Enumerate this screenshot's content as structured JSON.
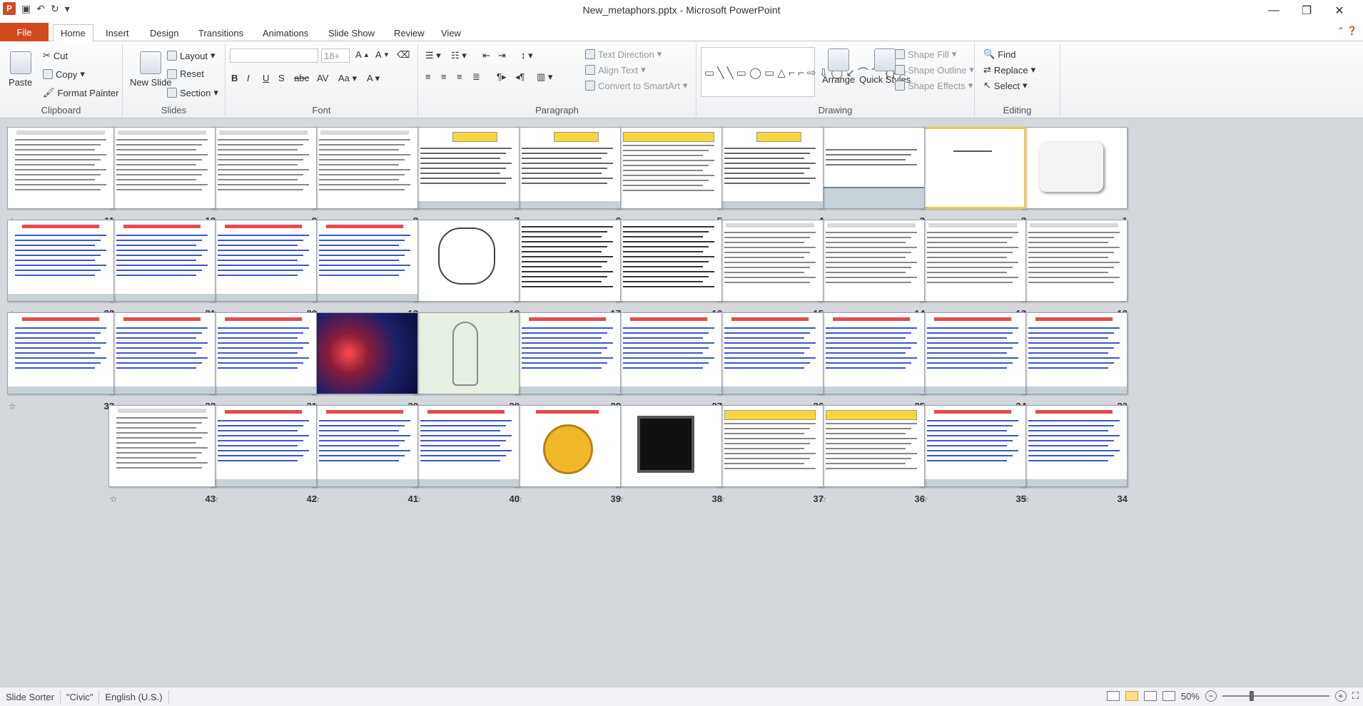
{
  "window": {
    "title": "New_metaphors.pptx - Microsoft PowerPoint",
    "minimize": "—",
    "maximize": "❐",
    "close": "✕"
  },
  "tabs": {
    "file": "File",
    "items": [
      "Home",
      "Insert",
      "Design",
      "Transitions",
      "Animations",
      "Slide Show",
      "Review",
      "View"
    ],
    "active": "Home"
  },
  "ribbon": {
    "clipboard": {
      "label": "Clipboard",
      "paste": "Paste",
      "cut": "Cut",
      "copy": "Copy",
      "format_painter": "Format Painter"
    },
    "slides": {
      "label": "Slides",
      "new_slide": "New Slide",
      "layout": "Layout",
      "reset": "Reset",
      "section": "Section"
    },
    "font": {
      "label": "Font",
      "size": "18+"
    },
    "paragraph": {
      "label": "Paragraph",
      "text_direction": "Text Direction",
      "align_text": "Align Text",
      "convert": "Convert to SmartArt"
    },
    "drawing": {
      "label": "Drawing",
      "arrange": "Arrange",
      "quick_styles": "Quick Styles",
      "shape_fill": "Shape Fill",
      "shape_outline": "Shape Outline",
      "shape_effects": "Shape Effects"
    },
    "editing": {
      "label": "Editing",
      "find": "Find",
      "replace": "Replace",
      "select": "Select"
    }
  },
  "slides": [
    {
      "n": "1",
      "kind": "calligraphy"
    },
    {
      "n": "2",
      "kind": "title",
      "selected": true
    },
    {
      "n": "3",
      "kind": "civic"
    },
    {
      "n": "4",
      "kind": "yellow"
    },
    {
      "n": "5",
      "kind": "table"
    },
    {
      "n": "6",
      "kind": "yellow"
    },
    {
      "n": "7",
      "kind": "yellow"
    },
    {
      "n": "8",
      "kind": "text"
    },
    {
      "n": "9",
      "kind": "text"
    },
    {
      "n": "10",
      "kind": "text"
    },
    {
      "n": "11",
      "kind": "text"
    },
    {
      "n": "12",
      "kind": "text"
    },
    {
      "n": "13",
      "kind": "text"
    },
    {
      "n": "14",
      "kind": "text"
    },
    {
      "n": "15",
      "kind": "text"
    },
    {
      "n": "16",
      "kind": "dense"
    },
    {
      "n": "17",
      "kind": "dense"
    },
    {
      "n": "18",
      "kind": "hexagon"
    },
    {
      "n": "19",
      "kind": "civic-red"
    },
    {
      "n": "20",
      "kind": "civic-red"
    },
    {
      "n": "21",
      "kind": "civic-red"
    },
    {
      "n": "22",
      "kind": "civic-red"
    },
    {
      "n": "23",
      "kind": "civic-red"
    },
    {
      "n": "24",
      "kind": "civic-red"
    },
    {
      "n": "25",
      "kind": "civic-red"
    },
    {
      "n": "26",
      "kind": "civic-red"
    },
    {
      "n": "27",
      "kind": "civic-red"
    },
    {
      "n": "28",
      "kind": "civic-red"
    },
    {
      "n": "29",
      "kind": "figure"
    },
    {
      "n": "30",
      "kind": "dark"
    },
    {
      "n": "31",
      "kind": "civic-red"
    },
    {
      "n": "32",
      "kind": "civic-red"
    },
    {
      "n": "33",
      "kind": "civic-red"
    },
    {
      "n": "34",
      "kind": "civic-red"
    },
    {
      "n": "35",
      "kind": "civic-red"
    },
    {
      "n": "36",
      "kind": "table"
    },
    {
      "n": "37",
      "kind": "table"
    },
    {
      "n": "38",
      "kind": "black"
    },
    {
      "n": "39",
      "kind": "gold"
    },
    {
      "n": "40",
      "kind": "civic-red"
    },
    {
      "n": "41",
      "kind": "civic-red"
    },
    {
      "n": "42",
      "kind": "civic-red"
    },
    {
      "n": "43",
      "kind": "text"
    }
  ],
  "status": {
    "view": "Slide Sorter",
    "theme": "\"Civic\"",
    "language": "English (U.S.)",
    "zoom": "50%"
  },
  "colors": {
    "file_tab": "#d04a1e",
    "workspace": "#d4d8dd",
    "selection": "#f2c94c"
  }
}
